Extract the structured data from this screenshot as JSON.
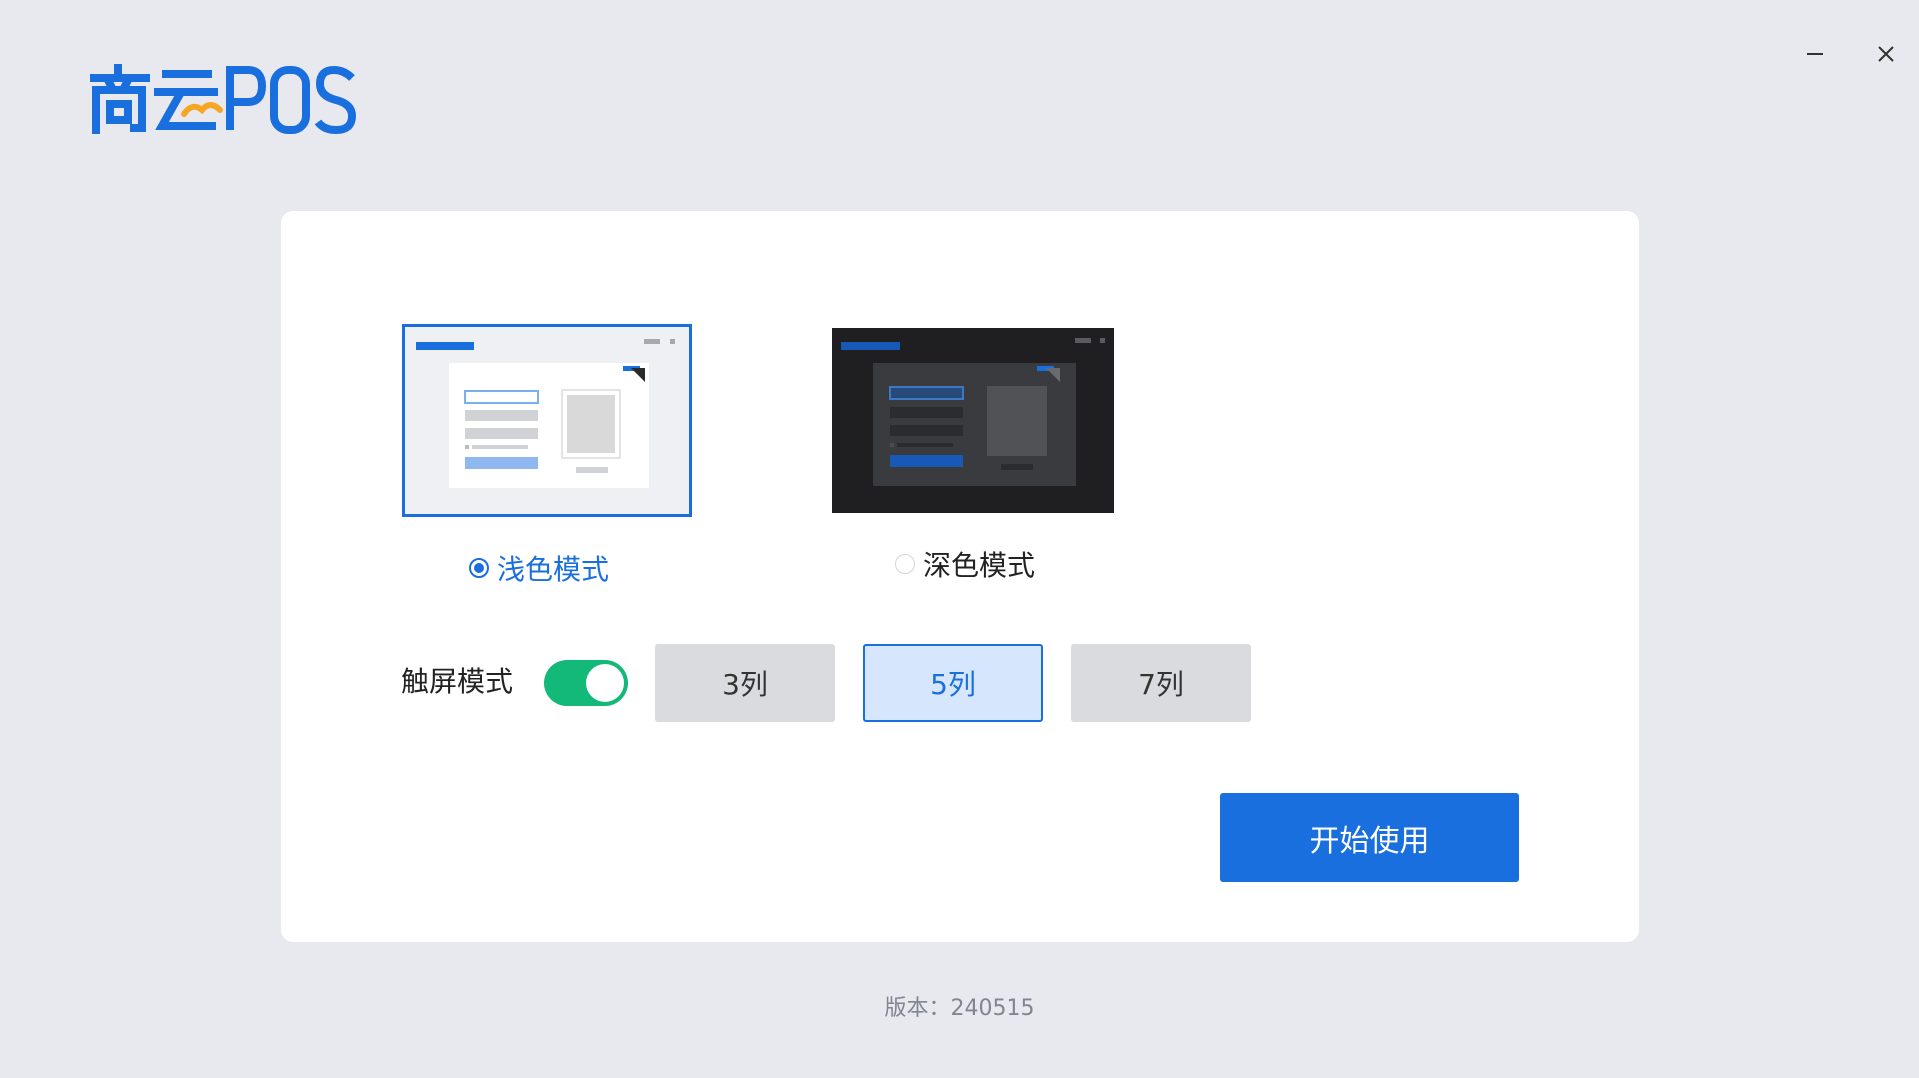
{
  "app": {
    "logo_text": "商云POS",
    "brand_color": "#1a6fdf",
    "accent_color": "#f5a623"
  },
  "window_controls": {
    "minimize_icon": "minimize-icon",
    "close_icon": "close-icon"
  },
  "theme_selector": {
    "options": [
      {
        "label": "浅色模式",
        "selected": true
      },
      {
        "label": "深色模式",
        "selected": false
      }
    ]
  },
  "touch_mode": {
    "label": "触屏模式",
    "enabled": true,
    "on_color": "#13b978"
  },
  "columns": {
    "options": [
      "3列",
      "5列",
      "7列"
    ],
    "selected": "5列"
  },
  "actions": {
    "start_label": "开始使用"
  },
  "footer": {
    "version": "版本：240515"
  }
}
